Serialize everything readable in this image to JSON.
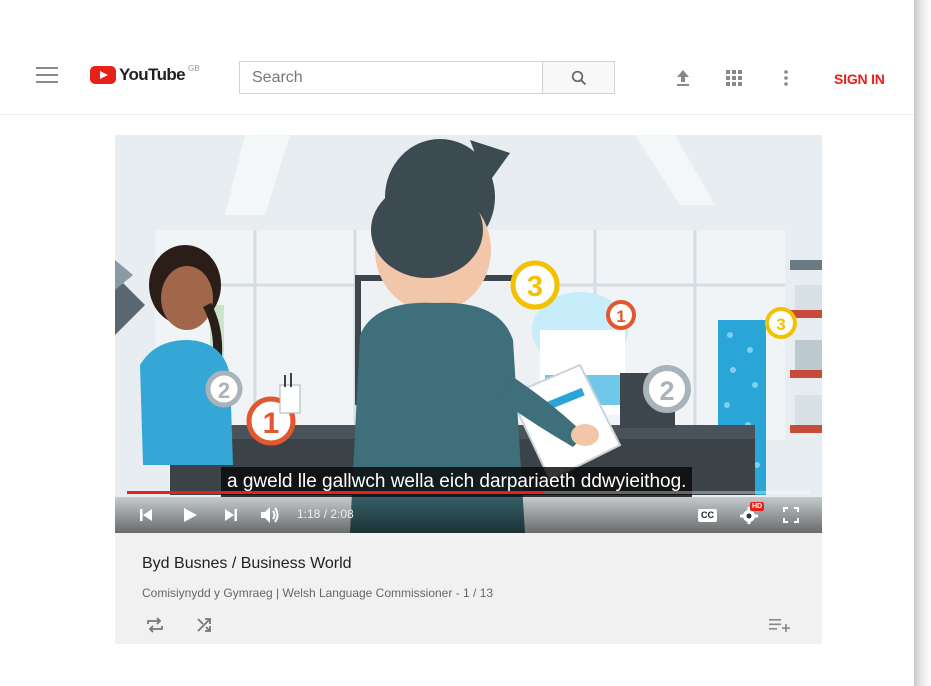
{
  "header": {
    "logo_text": "YouTube",
    "region": "GB",
    "search_placeholder": "Search",
    "sign_in": "SIGN IN",
    "icons": [
      "menu-icon",
      "search-icon",
      "upload-icon",
      "apps-icon",
      "more-icon"
    ]
  },
  "player": {
    "subtitle": "a gweld lle gallwch wella eich darpariaeth ddwyieithog.",
    "time": "1:18 / 2:08",
    "progress": 0.61,
    "cc_label": "CC",
    "hd_badge": "HD",
    "scene_numbers": [
      "1",
      "2",
      "3"
    ]
  },
  "video": {
    "title": "Byd Busnes / Business World",
    "channel": "Comisiynydd y Gymraeg | Welsh Language Commissioner - 1 / 13"
  },
  "colors": {
    "brand_red": "#e62117",
    "info_bg": "#f1f1f1"
  }
}
